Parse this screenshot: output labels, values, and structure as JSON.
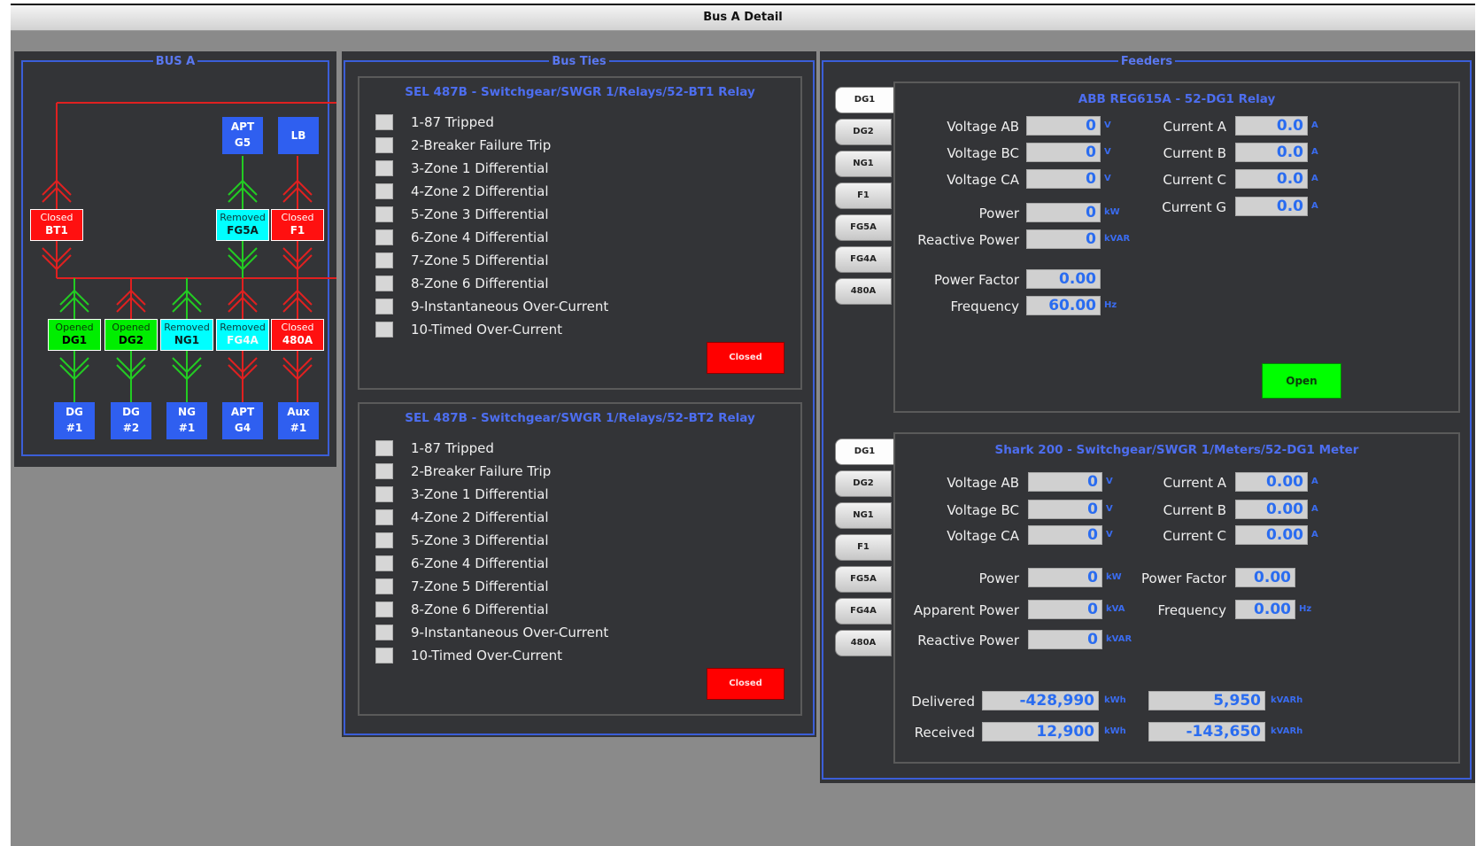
{
  "window": {
    "title": "Bus A Detail"
  },
  "bus_a": {
    "title": "BUS A",
    "top_sources": [
      {
        "line1": "APT",
        "line2": "G5"
      },
      {
        "line1": "LB",
        "line2": ""
      }
    ],
    "top_breakers": [
      {
        "status": "Closed",
        "name": "BT1",
        "color": "#ff1010"
      },
      {
        "status": "Removed",
        "name": "FG5A",
        "color": "#00ffff"
      },
      {
        "status": "Closed",
        "name": "F1",
        "color": "#ff1010"
      }
    ],
    "bottom_breakers": [
      {
        "status": "Opened",
        "name": "DG1",
        "color": "#00ee00"
      },
      {
        "status": "Opened",
        "name": "DG2",
        "color": "#00ee00"
      },
      {
        "status": "Removed",
        "name": "NG1",
        "color": "#00ffff"
      },
      {
        "status": "Removed",
        "name": "FG4A",
        "color": "#00ffff"
      },
      {
        "status": "Closed",
        "name": "480A",
        "color": "#ff1010"
      }
    ],
    "bottom_sources": [
      {
        "line1": "DG",
        "line2": "#1"
      },
      {
        "line1": "DG",
        "line2": "#2"
      },
      {
        "line1": "NG",
        "line2": "#1"
      },
      {
        "line1": "APT",
        "line2": "G4"
      },
      {
        "line1": "Aux",
        "line2": "#1"
      }
    ]
  },
  "bus_ties": {
    "title": "Bus Ties",
    "relays": [
      {
        "title": "SEL 487B - Switchgear/SWGR 1/Relays/52-BT1 Relay",
        "items": [
          "1-87 Tripped",
          "2-Breaker Failure Trip",
          "3-Zone 1 Differential",
          "4-Zone 2 Differential",
          "5-Zone 3 Differential",
          "6-Zone 4 Differential",
          "7-Zone 5 Differential",
          "8-Zone 6 Differential",
          "9-Instantaneous Over-Current",
          "10-Timed Over-Current"
        ],
        "button": "Closed"
      },
      {
        "title": "SEL 487B - Switchgear/SWGR 1/Relays/52-BT2 Relay",
        "items": [
          "1-87 Tripped",
          "2-Breaker Failure Trip",
          "3-Zone 1 Differential",
          "4-Zone 2 Differential",
          "5-Zone 3 Differential",
          "6-Zone 4 Differential",
          "7-Zone 5 Differential",
          "8-Zone 6 Differential",
          "9-Instantaneous Over-Current",
          "10-Timed Over-Current"
        ],
        "button": "Closed"
      }
    ]
  },
  "feeders": {
    "title": "Feeders",
    "tabs": [
      "DG1",
      "DG2",
      "NG1",
      "F1",
      "FG5A",
      "FG4A",
      "480A"
    ],
    "relay": {
      "title": "ABB REG615A - 52-DG1 Relay",
      "voltage_ab": {
        "label": "Voltage AB",
        "value": "0",
        "unit": "V"
      },
      "voltage_bc": {
        "label": "Voltage BC",
        "value": "0",
        "unit": "V"
      },
      "voltage_ca": {
        "label": "Voltage CA",
        "value": "0",
        "unit": "V"
      },
      "power": {
        "label": "Power",
        "value": "0",
        "unit": "kW"
      },
      "reactive_power": {
        "label": "Reactive Power",
        "value": "0",
        "unit": "kVAR"
      },
      "power_factor": {
        "label": "Power Factor",
        "value": "0.00"
      },
      "frequency": {
        "label": "Frequency",
        "value": "60.00",
        "unit": "Hz"
      },
      "current_a": {
        "label": "Current A",
        "value": "0.0",
        "unit": "A"
      },
      "current_b": {
        "label": "Current B",
        "value": "0.0",
        "unit": "A"
      },
      "current_c": {
        "label": "Current C",
        "value": "0.0",
        "unit": "A"
      },
      "current_g": {
        "label": "Current G",
        "value": "0.0",
        "unit": "A"
      },
      "button": "Open"
    },
    "meter": {
      "title": "Shark 200 - Switchgear/SWGR 1/Meters/52-DG1 Meter",
      "voltage_ab": {
        "label": "Voltage AB",
        "value": "0",
        "unit": "V"
      },
      "voltage_bc": {
        "label": "Voltage BC",
        "value": "0",
        "unit": "V"
      },
      "voltage_ca": {
        "label": "Voltage CA",
        "value": "0",
        "unit": "V"
      },
      "power": {
        "label": "Power",
        "value": "0",
        "unit": "kW"
      },
      "apparent_power": {
        "label": "Apparent Power",
        "value": "0",
        "unit": "kVA"
      },
      "reactive_power": {
        "label": "Reactive Power",
        "value": "0",
        "unit": "kVAR"
      },
      "current_a": {
        "label": "Current A",
        "value": "0.00",
        "unit": "A"
      },
      "current_b": {
        "label": "Current B",
        "value": "0.00",
        "unit": "A"
      },
      "current_c": {
        "label": "Current C",
        "value": "0.00",
        "unit": "A"
      },
      "power_factor": {
        "label": "Power Factor",
        "value": "0.00"
      },
      "frequency": {
        "label": "Frequency",
        "value": "0.00",
        "unit": "Hz"
      },
      "delivered": {
        "label": "Delivered",
        "kwh": "-428,990",
        "kwh_unit": "kWh",
        "kvarh": "5,950",
        "kvarh_unit": "kVARh"
      },
      "received": {
        "label": "Received",
        "kwh": "12,900",
        "kwh_unit": "kWh",
        "kvarh": "-143,650",
        "kvarh_unit": "kVARh"
      }
    }
  }
}
